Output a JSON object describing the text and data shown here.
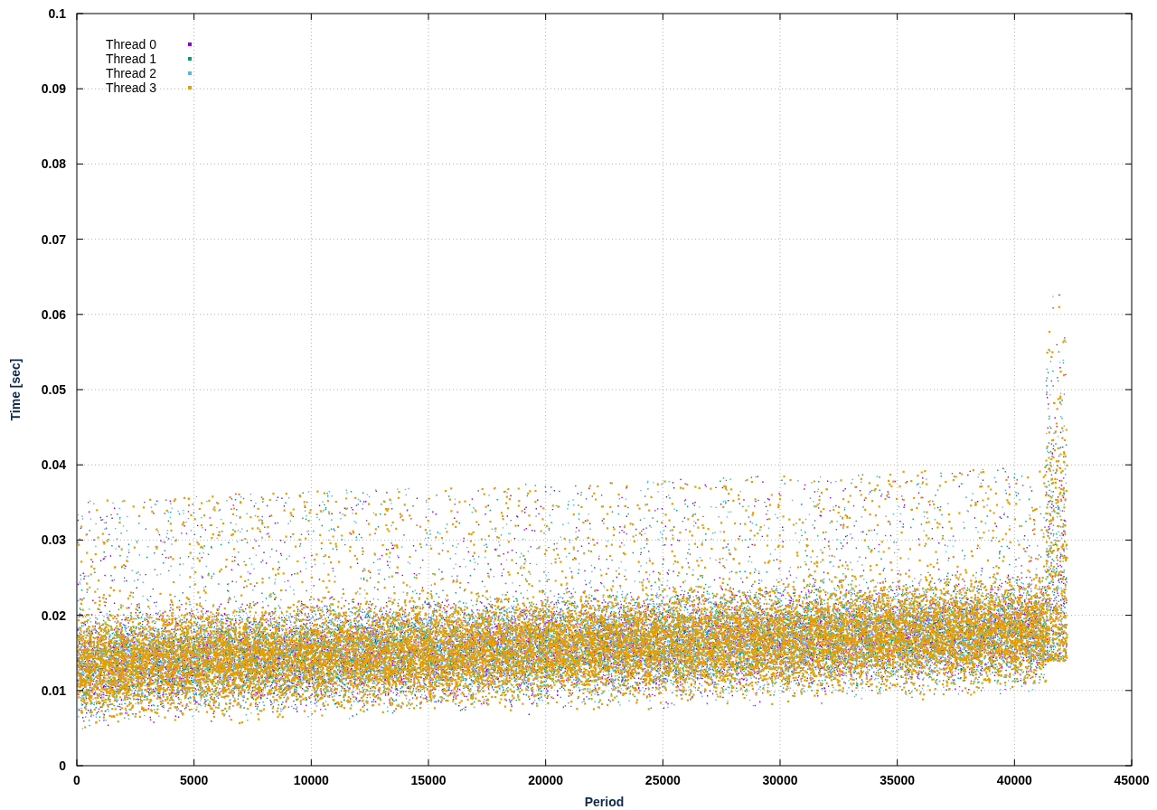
{
  "plot": {
    "y_axis_title": "Time [sec]",
    "x_axis_title": "Period",
    "y_tick_labels": [
      "0.1",
      "0.09",
      "0.08",
      "0.07",
      "0.06",
      "0.05",
      "0.04",
      "0.03",
      "0.02",
      "0.01",
      "0"
    ],
    "x_tick_labels": [
      "0",
      "5000",
      "10000",
      "15000",
      "20000",
      "25000",
      "30000",
      "35000",
      "40000",
      "45000"
    ],
    "legend": [
      {
        "label": "Thread 0",
        "color": "#9400d3"
      },
      {
        "label": "Thread 1",
        "color": "#009e73"
      },
      {
        "label": "Thread 2",
        "color": "#56b4e9"
      },
      {
        "label": "Thread 3",
        "color": "#e69f00"
      }
    ]
  }
}
